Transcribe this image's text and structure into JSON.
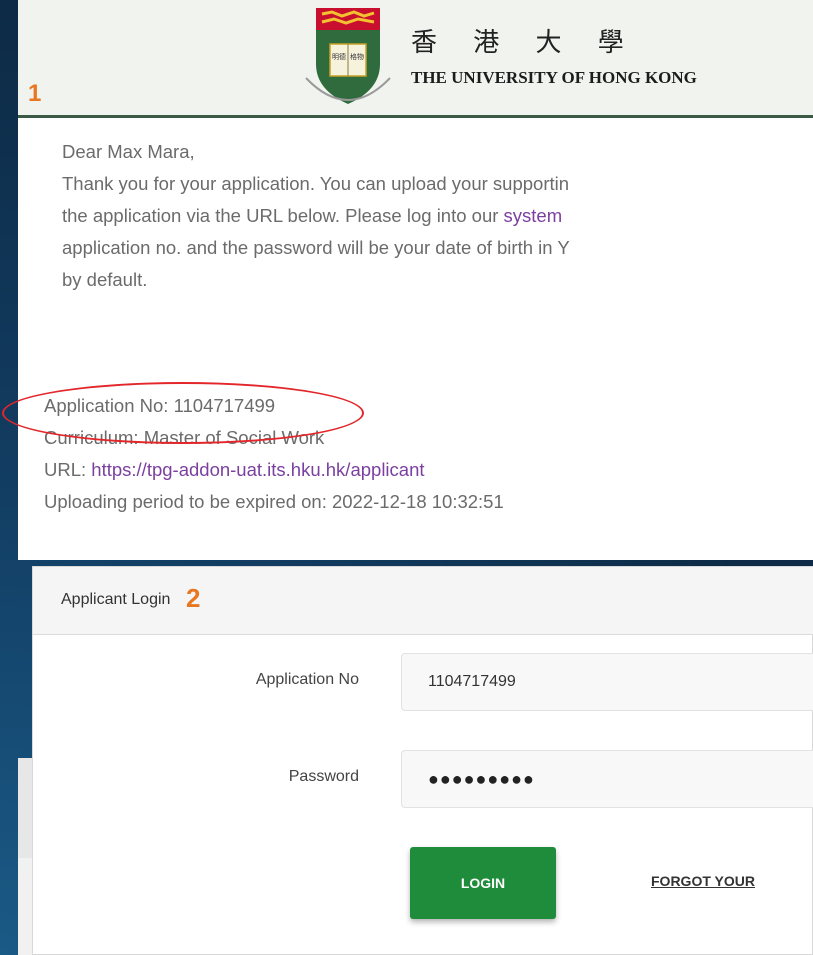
{
  "header": {
    "step_number": "1",
    "university_name_zh": "香 港 大 學",
    "university_name_en": "THE UNIVERSITY OF HONG KONG"
  },
  "email": {
    "greeting": "Dear Max Mara,",
    "line1": "Thank you for your application. You can upload your supportin",
    "line2_before_link": "the application via the URL below. Please log into our ",
    "line2_link": "system",
    "line3": "application no. and the password will be your date of birth in Y",
    "line4": "by default.",
    "application_no": "Application No: 1104717499",
    "curriculum": "Curriculum: Master of Social Work",
    "url_label": "URL: ",
    "url_link": "https://tpg-addon-uat.its.hku.hk/applicant",
    "expiry": "Uploading period to be expired on: 2022-12-18 10:32:51"
  },
  "login": {
    "title": "Applicant Login",
    "step_number": "2",
    "application_no_label": "Application No",
    "application_no_value": "1104717499",
    "password_label": "Password",
    "password_value": "●●●●●●●●●",
    "login_button": "LOGIN",
    "forgot_link": "FORGOT YOUR"
  },
  "colors": {
    "accent_orange": "#e87722",
    "highlight_red": "#e3262a",
    "login_green": "#1e8c3a",
    "link_purple": "#7b3fa0"
  }
}
